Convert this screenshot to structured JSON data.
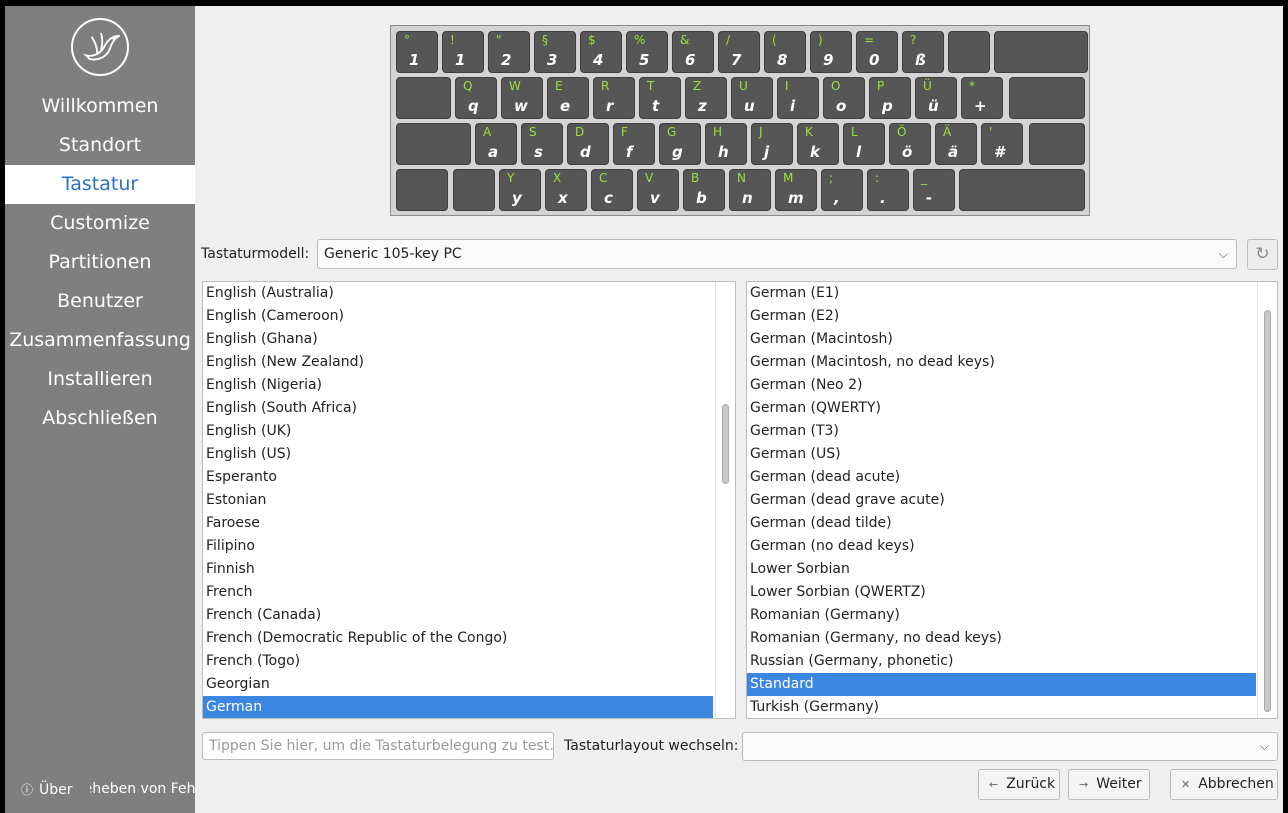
{
  "sidebar": {
    "items": [
      {
        "label": "Willkommen"
      },
      {
        "label": "Standort"
      },
      {
        "label": "Tastatur"
      },
      {
        "label": "Customize"
      },
      {
        "label": "Partitionen"
      },
      {
        "label": "Benutzer"
      },
      {
        "label": "Zusammenfassung"
      },
      {
        "label": "Installieren"
      },
      {
        "label": "Abschließen"
      }
    ],
    "active_index": 2,
    "about_label": "Über",
    "debug_label": "Beheben von Fehlern"
  },
  "keyboard": {
    "rows": [
      [
        [
          "°",
          "1"
        ],
        [
          "!",
          "1"
        ],
        [
          "\"",
          "2"
        ],
        [
          "§",
          "3"
        ],
        [
          "$",
          "4"
        ],
        [
          "%",
          "5"
        ],
        [
          "&",
          "6"
        ],
        [
          "/",
          "7"
        ],
        [
          "(",
          "8"
        ],
        [
          ")",
          "9"
        ],
        [
          "=",
          "0"
        ],
        [
          "?",
          "ß"
        ],
        [
          "",
          ""
        ],
        [
          "",
          ""
        ]
      ],
      [
        [
          "",
          ""
        ],
        [
          "Q",
          "q"
        ],
        [
          "W",
          "w"
        ],
        [
          "E",
          "e"
        ],
        [
          "R",
          "r"
        ],
        [
          "T",
          "t"
        ],
        [
          "Z",
          "z"
        ],
        [
          "U",
          "u"
        ],
        [
          "I",
          "i"
        ],
        [
          "O",
          "o"
        ],
        [
          "P",
          "p"
        ],
        [
          "Ü",
          "ü"
        ],
        [
          "*",
          "+"
        ],
        [
          "",
          ""
        ]
      ],
      [
        [
          "",
          ""
        ],
        [
          "A",
          "a"
        ],
        [
          "S",
          "s"
        ],
        [
          "D",
          "d"
        ],
        [
          "F",
          "f"
        ],
        [
          "G",
          "g"
        ],
        [
          "H",
          "h"
        ],
        [
          "J",
          "j"
        ],
        [
          "K",
          "k"
        ],
        [
          "L",
          "l"
        ],
        [
          "Ö",
          "ö"
        ],
        [
          "Ä",
          "ä"
        ],
        [
          "'",
          "#"
        ],
        [
          "",
          ""
        ]
      ],
      [
        [
          "",
          ""
        ],
        [
          "",
          ""
        ],
        [
          "Y",
          "y"
        ],
        [
          "X",
          "x"
        ],
        [
          "C",
          "c"
        ],
        [
          "V",
          "v"
        ],
        [
          "B",
          "b"
        ],
        [
          "N",
          "n"
        ],
        [
          "M",
          "m"
        ],
        [
          ";",
          ","
        ],
        [
          ":",
          "."
        ],
        [
          "_",
          "-"
        ],
        [
          "",
          ""
        ]
      ]
    ]
  },
  "model": {
    "label": "Tastaturmodell:",
    "value": "Generic 105-key PC"
  },
  "layouts": {
    "items": [
      "English (Australia)",
      "English (Cameroon)",
      "English (Ghana)",
      "English (New Zealand)",
      "English (Nigeria)",
      "English (South Africa)",
      "English (UK)",
      "English (US)",
      "Esperanto",
      "Estonian",
      "Faroese",
      "Filipino",
      "Finnish",
      "French",
      "French (Canada)",
      "French (Democratic Republic of the Congo)",
      "French (Togo)",
      "Georgian",
      "German"
    ],
    "selected": "German"
  },
  "variants": {
    "items": [
      "German (E1)",
      "German (E2)",
      "German (Macintosh)",
      "German (Macintosh, no dead keys)",
      "German (Neo 2)",
      "German (QWERTY)",
      "German (T3)",
      "German (US)",
      "German (dead acute)",
      "German (dead grave acute)",
      "German (dead tilde)",
      "German (no dead keys)",
      "Lower Sorbian",
      "Lower Sorbian (QWERTZ)",
      "Romanian (Germany)",
      "Romanian (Germany, no dead keys)",
      "Russian (Germany, phonetic)",
      "Standard",
      "Turkish (Germany)"
    ],
    "selected": "Standard"
  },
  "test_input": {
    "placeholder": "Tippen Sie hier, um die Tastaturbelegung zu test…",
    "value": ""
  },
  "switch": {
    "label": "Tastaturlayout wechseln:",
    "value": ""
  },
  "buttons": {
    "back": "Zurück",
    "next": "Weiter",
    "cancel": "Abbrechen"
  },
  "colors": {
    "sidebar_bg": "#7f7f7f",
    "accent": "#3b86e0",
    "active_text": "#2d72c2",
    "key_bg": "#565656",
    "key_shift_text": "#9ae13a"
  }
}
